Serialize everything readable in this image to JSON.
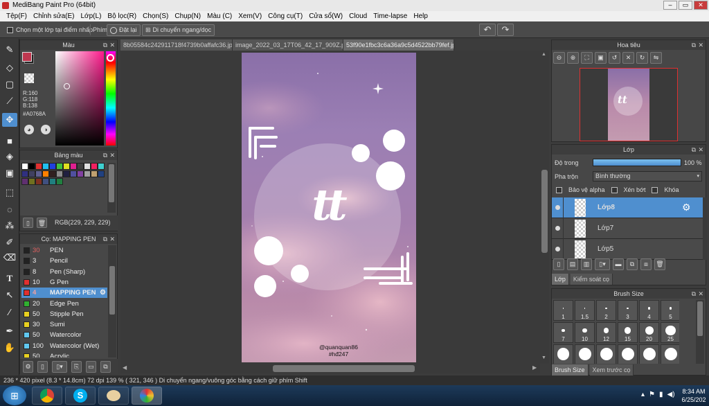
{
  "window": {
    "title": "MediBang Paint Pro (64bit)"
  },
  "menu": [
    "Tệp(F)",
    "Chỉnh sửa(E)",
    "Lớp(L)",
    "Bộ lọc(R)",
    "Chọn(S)",
    "Chụp(N)",
    "Màu (C)",
    "Xem(V)",
    "Công cụ(T)",
    "Cửa sổ(W)",
    "Cloud",
    "Time-lapse",
    "Help"
  ],
  "options": {
    "select_layer_label": "Chọn một lớp tại điểm nhấp",
    "key_label": "Phím",
    "reset_label": "Đặt lại",
    "move_label": "Di chuyển ngang/dọc"
  },
  "color_panel": {
    "title": "Màu",
    "r": "R:160",
    "g": "G:118",
    "b": "B:138",
    "hex": "#A0768A"
  },
  "palette_panel": {
    "title": "Bảng màu",
    "rgb": "RGB(229, 229, 229)"
  },
  "brush_panel": {
    "title": "Cọ: MAPPING PEN",
    "items": [
      {
        "size": "30",
        "name": "PEN",
        "color": "#222222"
      },
      {
        "size": "3",
        "name": "Pencil",
        "color": "#222222"
      },
      {
        "size": "8",
        "name": "Pen (Sharp)",
        "color": "#222222"
      },
      {
        "size": "10",
        "name": "G Pen",
        "color": "#e03030"
      },
      {
        "size": "4",
        "name": "MAPPING PEN",
        "color": "#e03030"
      },
      {
        "size": "20",
        "name": "Edge Pen",
        "color": "#30b030"
      },
      {
        "size": "50",
        "name": "Stipple Pen",
        "color": "#e8d020"
      },
      {
        "size": "30",
        "name": "Sumi",
        "color": "#e8d020"
      },
      {
        "size": "50",
        "name": "Watercolor",
        "color": "#60c8f0"
      },
      {
        "size": "100",
        "name": "Watercolor (Wet)",
        "color": "#60c8f0"
      },
      {
        "size": "50",
        "name": "Acrylic",
        "color": "#e8d020"
      }
    ]
  },
  "tabs": [
    "8b05584c242911718f4739b0affafc36.jpg",
    "image_2022_03_17T06_42_17_909Z.png",
    "53f90e1fbc3c6a36a9c5d4522bb79fef.jpg"
  ],
  "artwork": {
    "text": "tt",
    "credit1": "@quanquan86",
    "credit2": "#hđ247"
  },
  "navigator": {
    "title": "Hoa tiêu"
  },
  "layer_panel": {
    "title": "Lớp",
    "opacity_label": "Độ trong",
    "opacity_value": "100 %",
    "opacity_fraction": 1.0,
    "blend_label": "Pha trộn",
    "blend_value": "Bình thường",
    "protect_alpha": "Bảo vệ alpha",
    "clipping": "Xén bớt",
    "lock": "Khóa",
    "layers": [
      "Lớp8",
      "Lớp7",
      "Lớp5"
    ],
    "tab_layer": "Lớp",
    "tab_control": "Kiểm soát cọ"
  },
  "brush_size_panel": {
    "title": "Brush Size",
    "sizes": [
      "1",
      "1.5",
      "2",
      "3",
      "4",
      "5",
      "7",
      "10",
      "12",
      "15",
      "20",
      "25"
    ],
    "tab1": "Brush Size",
    "tab2": "Xem trước cọ"
  },
  "status": {
    "text": "236 * 420 pixel  (8.3 * 14.8cm)  72 dpi  139 %  ( 321, 346 )  Di chuyển ngang/vuông góc bằng cách giữ phím Shift"
  },
  "taskbar": {
    "time": "8:34 AM",
    "date": "6/25/202"
  },
  "colors": {
    "accent": "#4f8fcf",
    "main_color": "#A0768A"
  }
}
